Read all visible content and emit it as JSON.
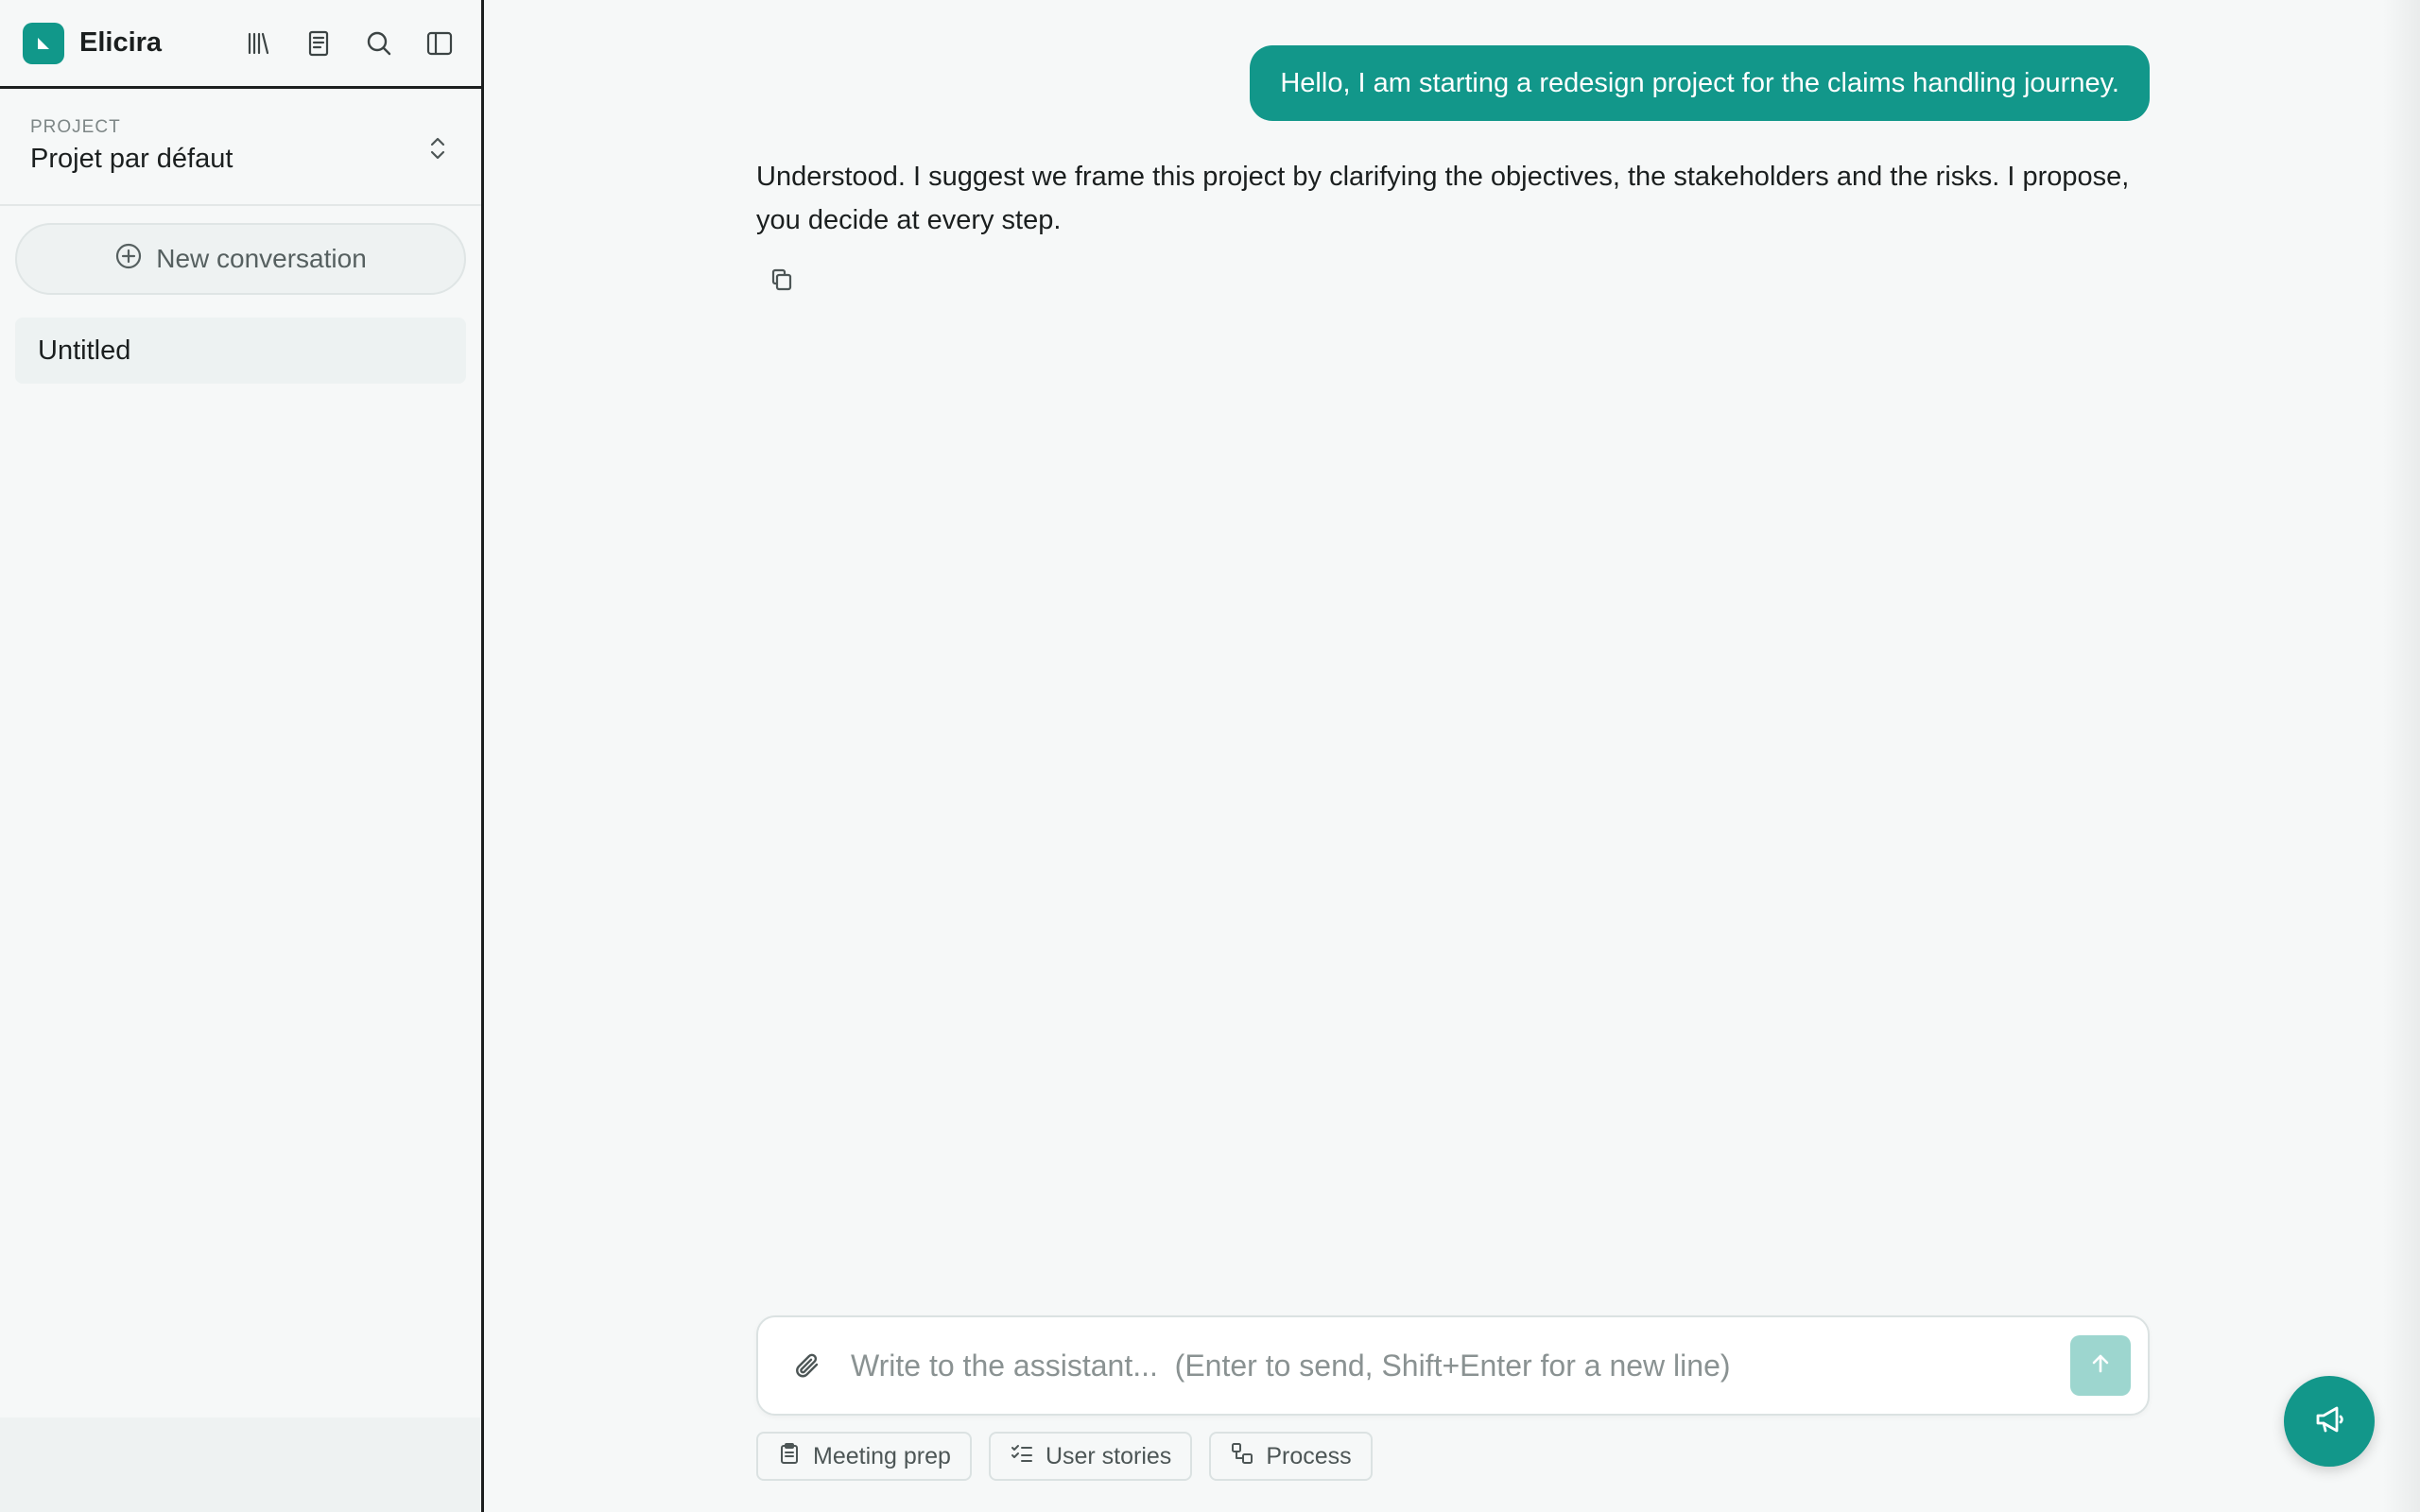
{
  "app": {
    "name": "Elicira",
    "accent_color": "#12978a"
  },
  "sidebar": {
    "header_icons": [
      "library-icon",
      "notebook-icon",
      "search-icon",
      "sidebar-toggle-icon"
    ],
    "project": {
      "label": "PROJECT",
      "name": "Projet par défaut"
    },
    "new_conversation_label": "New conversation",
    "conversations": [
      {
        "title": "Untitled",
        "selected": true
      }
    ]
  },
  "chat": {
    "messages": [
      {
        "role": "user",
        "text": "Hello, I am starting a redesign project for the claims handling journey."
      },
      {
        "role": "assistant",
        "text": "Understood. I suggest we frame this project by clarifying the objectives, the stakeholders and the risks. I propose, you decide at every step."
      }
    ]
  },
  "composer": {
    "placeholder": "Write to the assistant...  (Enter to send, Shift+Enter for a new line)",
    "value": ""
  },
  "quick_actions": [
    {
      "label": "Meeting prep",
      "icon": "clipboard-icon"
    },
    {
      "label": "User stories",
      "icon": "checklist-icon"
    },
    {
      "label": "Process",
      "icon": "process-icon"
    }
  ]
}
